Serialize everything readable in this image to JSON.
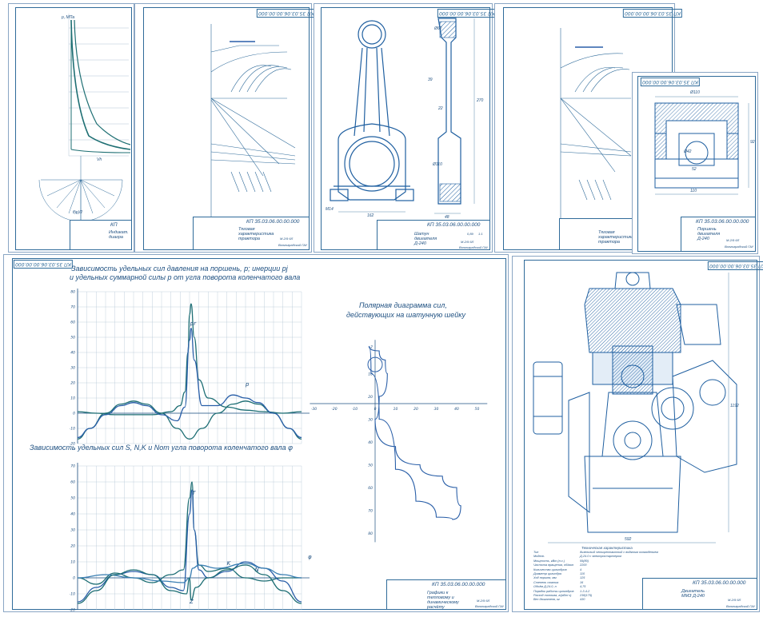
{
  "sheets": {
    "s1": {
      "title_code": "КП",
      "title_name": "Индикат. диагра",
      "axis_y": "p, МПа",
      "axis_x": "Vh",
      "fphi": "f(φ)/2"
    },
    "s2": {
      "stamp_code": "КП 35.03.06.00.00.000",
      "title_name": "Тяговая характеристика трактора",
      "uni": "Волгоградский ГАУ",
      "group": "М-2/9 6Л"
    },
    "s3": {
      "stamp_code": "КП 35.03.06.00.00.000",
      "title_name": "Шатун двигателя Д-240",
      "uni": "Волгоградский ГАУ",
      "scale": "1:1",
      "mass": "0,89",
      "group": "М-2/9 6Л",
      "dims": {
        "d1": "Ø62",
        "d2": "39",
        "d3": "Ø90",
        "d4": "162",
        "d5": "48",
        "d6": "Ø110",
        "d7": "270",
        "d8": "22",
        "d9": "М14"
      }
    },
    "s4": {
      "stamp_code": "КП 35.03.06.00.00.000",
      "title_name": "Тяговая характеристика трактора"
    },
    "s5": {
      "stamp_code": "КП 35.03.06.00.00.000",
      "title_name": "Поршень двигателя Д-240",
      "uni": "Волгоградский ГАУ",
      "group": "М-2/9 6Л",
      "corner_code": "КП 35.03.06.00.00.000",
      "dims": {
        "d1": "Ø110",
        "d2": "Ø42",
        "d3": "52",
        "d4": "110",
        "d5": "92"
      }
    },
    "s6": {
      "corner_code": "КП 35.03.06.00.00.000",
      "chart1_title_line1": "Зависимость удельных сил давления на поршень, p; инерции pj",
      "chart1_title_line2": "и удельных суммарной силы p от угла поворота коленчатого вала",
      "chart2_title": "Зависимость удельных сил S, N,K и Nот угла поворота коленчатого вала φ",
      "polar_title_line1": "Полярная диаграмма сил,",
      "polar_title_line2": "действующих на шатунную шейку",
      "stamp_code": "КП 35.03.06.00.00.000",
      "title_name": "Графики к тепловому и динамическому расчёту",
      "uni": "Волгоградский ГАУ",
      "group": "М-2/9 6Л",
      "c1_labels": {
        "pj": "pj",
        "p": "p",
        "pr": "pr"
      },
      "c2_labels": {
        "T": "T",
        "K": "K",
        "N": "N",
        "Z": "Z",
        "phi": "φ"
      }
    },
    "s7": {
      "corner_code": "КП 35.03.06.00.00.000",
      "stamp_code": "КП 35.03.06.00.00.000",
      "title_name": "Двигатель ММЗ Д-240",
      "uni": "Волгоградский ГАУ",
      "group": "М-2/9 6Л",
      "dim_h": "1192",
      "dim_w": "592",
      "spec_title": "Техническая характеристика",
      "spec": [
        [
          "Тип",
          "дизельный четырехтактный с водяным охлаждением"
        ],
        [
          "Модель",
          "Д-24.0 с электростартером"
        ],
        [
          "Мощность, кВт (л.с.)",
          "59(80)"
        ],
        [
          "Частота вращения, об/мин",
          "2200"
        ],
        [
          "Количество цилиндров",
          "4"
        ],
        [
          "Диаметр цилиндра",
          "110"
        ],
        [
          "Ход поршня, мм",
          "125"
        ],
        [
          "Степень сжатия",
          "16"
        ],
        [
          "Объём Д-24.0, л",
          "4,75"
        ],
        [
          "Порядок работы цилиндров",
          "1-3-4-2"
        ],
        [
          "Расход топлива, г/(кВт·ч)",
          "238(175)"
        ],
        [
          "Вес двигателя, кг",
          "430"
        ]
      ]
    }
  },
  "chart_data": [
    {
      "type": "line",
      "title": "Зависимость удельных сил давления на поршень, p; инерции pj и удельных суммарной силы p от угла поворота коленчатого вала",
      "ylim": [
        -20,
        80
      ],
      "yticks": [
        80,
        70,
        60,
        50,
        40,
        30,
        20,
        10,
        0,
        -10,
        -20
      ],
      "xlim": [
        0,
        720
      ],
      "grid": true,
      "series": [
        {
          "name": "pr",
          "x": [
            0,
            60,
            120,
            180,
            240,
            300,
            330,
            345,
            355,
            360,
            365,
            375,
            390,
            420,
            480,
            540,
            600,
            660,
            720
          ],
          "y": [
            1,
            0,
            -1,
            -1,
            -1,
            1,
            5,
            14,
            40,
            65,
            72,
            50,
            22,
            10,
            4,
            2,
            1,
            0,
            1
          ]
        },
        {
          "name": "pj",
          "x": [
            0,
            40,
            90,
            140,
            180,
            220,
            270,
            320,
            360,
            400,
            450,
            500,
            540,
            580,
            630,
            680,
            720
          ],
          "y": [
            -17,
            -10,
            0,
            6,
            8,
            6,
            0,
            -10,
            -17,
            -10,
            0,
            6,
            8,
            6,
            0,
            -10,
            -17
          ]
        },
        {
          "name": "p",
          "x": [
            0,
            40,
            90,
            140,
            180,
            220,
            270,
            320,
            345,
            360,
            365,
            375,
            400,
            450,
            500,
            540,
            580,
            630,
            680,
            720
          ],
          "y": [
            -16,
            -10,
            -1,
            5,
            7,
            5,
            -1,
            -5,
            4,
            48,
            56,
            35,
            5,
            5,
            12,
            10,
            7,
            0,
            -10,
            -16
          ]
        }
      ]
    },
    {
      "type": "line",
      "title": "Зависимость удельных сил S, N,K и Nот угла поворота коленчатого вала φ",
      "ylim": [
        -20,
        70
      ],
      "yticks": [
        70,
        60,
        50,
        40,
        30,
        20,
        10,
        0,
        -10,
        -20
      ],
      "xlim": [
        0,
        720
      ],
      "grid": true,
      "series": [
        {
          "name": "T",
          "x": [
            0,
            60,
            120,
            180,
            240,
            300,
            340,
            360,
            368,
            375,
            390,
            420,
            480,
            540,
            600,
            660,
            720
          ],
          "y": [
            0,
            -4,
            3,
            0,
            -3,
            2,
            5,
            50,
            60,
            30,
            8,
            4,
            6,
            0,
            -2,
            0,
            0
          ]
        },
        {
          "name": "K",
          "x": [
            0,
            60,
            120,
            180,
            240,
            300,
            340,
            360,
            368,
            375,
            390,
            420,
            480,
            540,
            600,
            660,
            720
          ],
          "y": [
            -15,
            -6,
            2,
            4,
            2,
            -6,
            -8,
            40,
            55,
            30,
            5,
            0,
            4,
            10,
            6,
            -2,
            -15
          ]
        },
        {
          "name": "N",
          "x": [
            0,
            90,
            180,
            270,
            340,
            360,
            370,
            390,
            450,
            540,
            600,
            660,
            720
          ],
          "y": [
            0,
            2,
            0,
            -2,
            -3,
            0,
            6,
            8,
            6,
            9,
            6,
            2,
            0
          ]
        },
        {
          "name": "Z",
          "x": [
            0,
            60,
            120,
            180,
            240,
            300,
            350,
            360,
            365,
            380,
            420,
            480,
            540,
            600,
            660,
            720
          ],
          "y": [
            -16,
            -8,
            2,
            5,
            2,
            -8,
            -10,
            0,
            -14,
            -6,
            0,
            5,
            8,
            2,
            -8,
            -16
          ]
        }
      ]
    },
    {
      "type": "scatter",
      "title": "Полярная диаграмма сил, действующих на шатунную шейку",
      "xticks": [
        -30,
        -20,
        -10,
        0,
        10,
        20,
        30,
        40,
        50
      ],
      "yticks": [
        -2,
        10,
        20,
        30,
        40,
        50,
        60,
        70,
        80
      ],
      "series": [
        {
          "name": "R",
          "x": [
            -3,
            2,
            5,
            6,
            2,
            0,
            10,
            22,
            33,
            40,
            42,
            38,
            30,
            20,
            10,
            2,
            -2,
            -3
          ],
          "y": [
            -2,
            0,
            4,
            10,
            20,
            30,
            42,
            50,
            55,
            60,
            68,
            74,
            73,
            66,
            52,
            30,
            10,
            -2
          ]
        }
      ]
    }
  ]
}
